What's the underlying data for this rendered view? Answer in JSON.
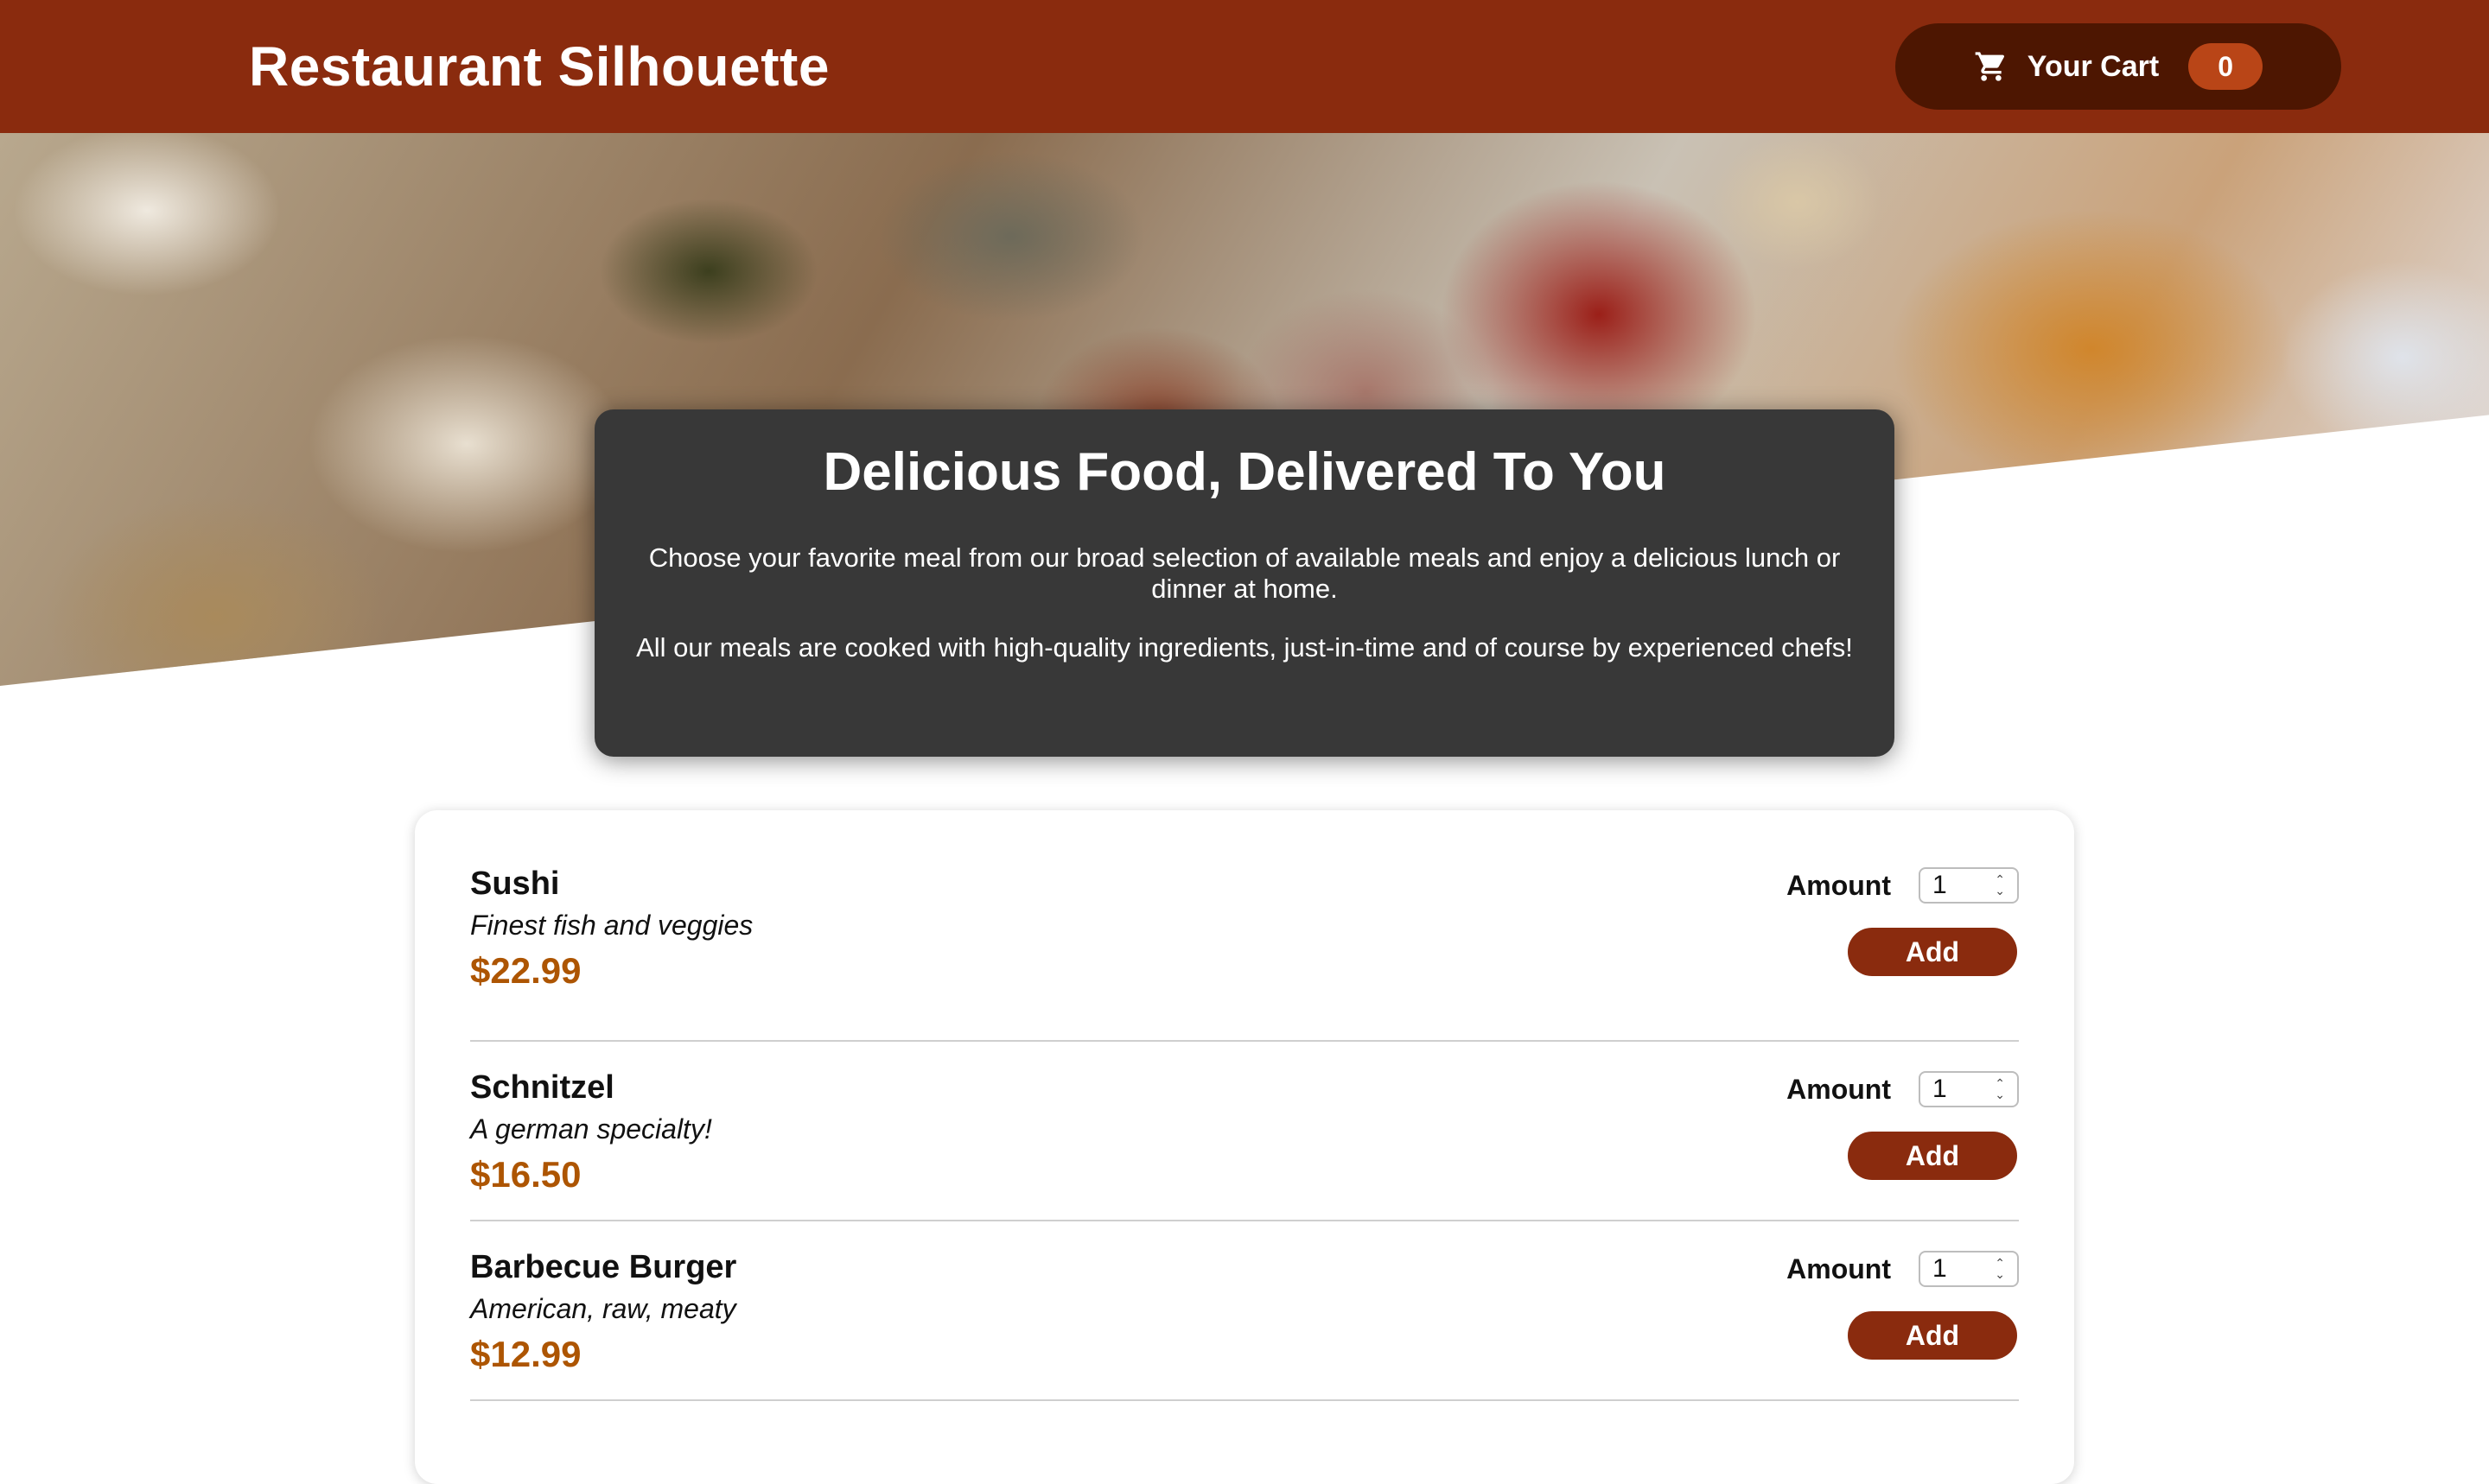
{
  "header": {
    "title": "Restaurant Silhouette",
    "cart": {
      "label": "Your Cart",
      "count": "0",
      "icon": "cart-icon"
    }
  },
  "summary": {
    "title": "Delicious Food, Delivered To You",
    "paragraphs": [
      "Choose your favorite meal from our broad selection of available meals and enjoy a delicious lunch or dinner at home.",
      "All our meals are cooked with high-quality ingredients, just-in-time and of course by experienced chefs!"
    ]
  },
  "meals": [
    {
      "name": "Sushi",
      "description": "Finest fish and veggies",
      "price": "$22.99",
      "amount_label": "Amount",
      "amount": "1",
      "add_label": "Add"
    },
    {
      "name": "Schnitzel",
      "description": "A german specialty!",
      "price": "$16.50",
      "amount_label": "Amount",
      "amount": "1",
      "add_label": "Add"
    },
    {
      "name": "Barbecue Burger",
      "description": "American, raw, meaty",
      "price": "$12.99",
      "amount_label": "Amount",
      "amount": "1",
      "add_label": "Add"
    }
  ],
  "colors": {
    "header": "#8a2b0e",
    "cart_button": "#4d1601",
    "cart_badge": "#b94517",
    "price": "#ad5502",
    "summary_bg": "#383838"
  }
}
